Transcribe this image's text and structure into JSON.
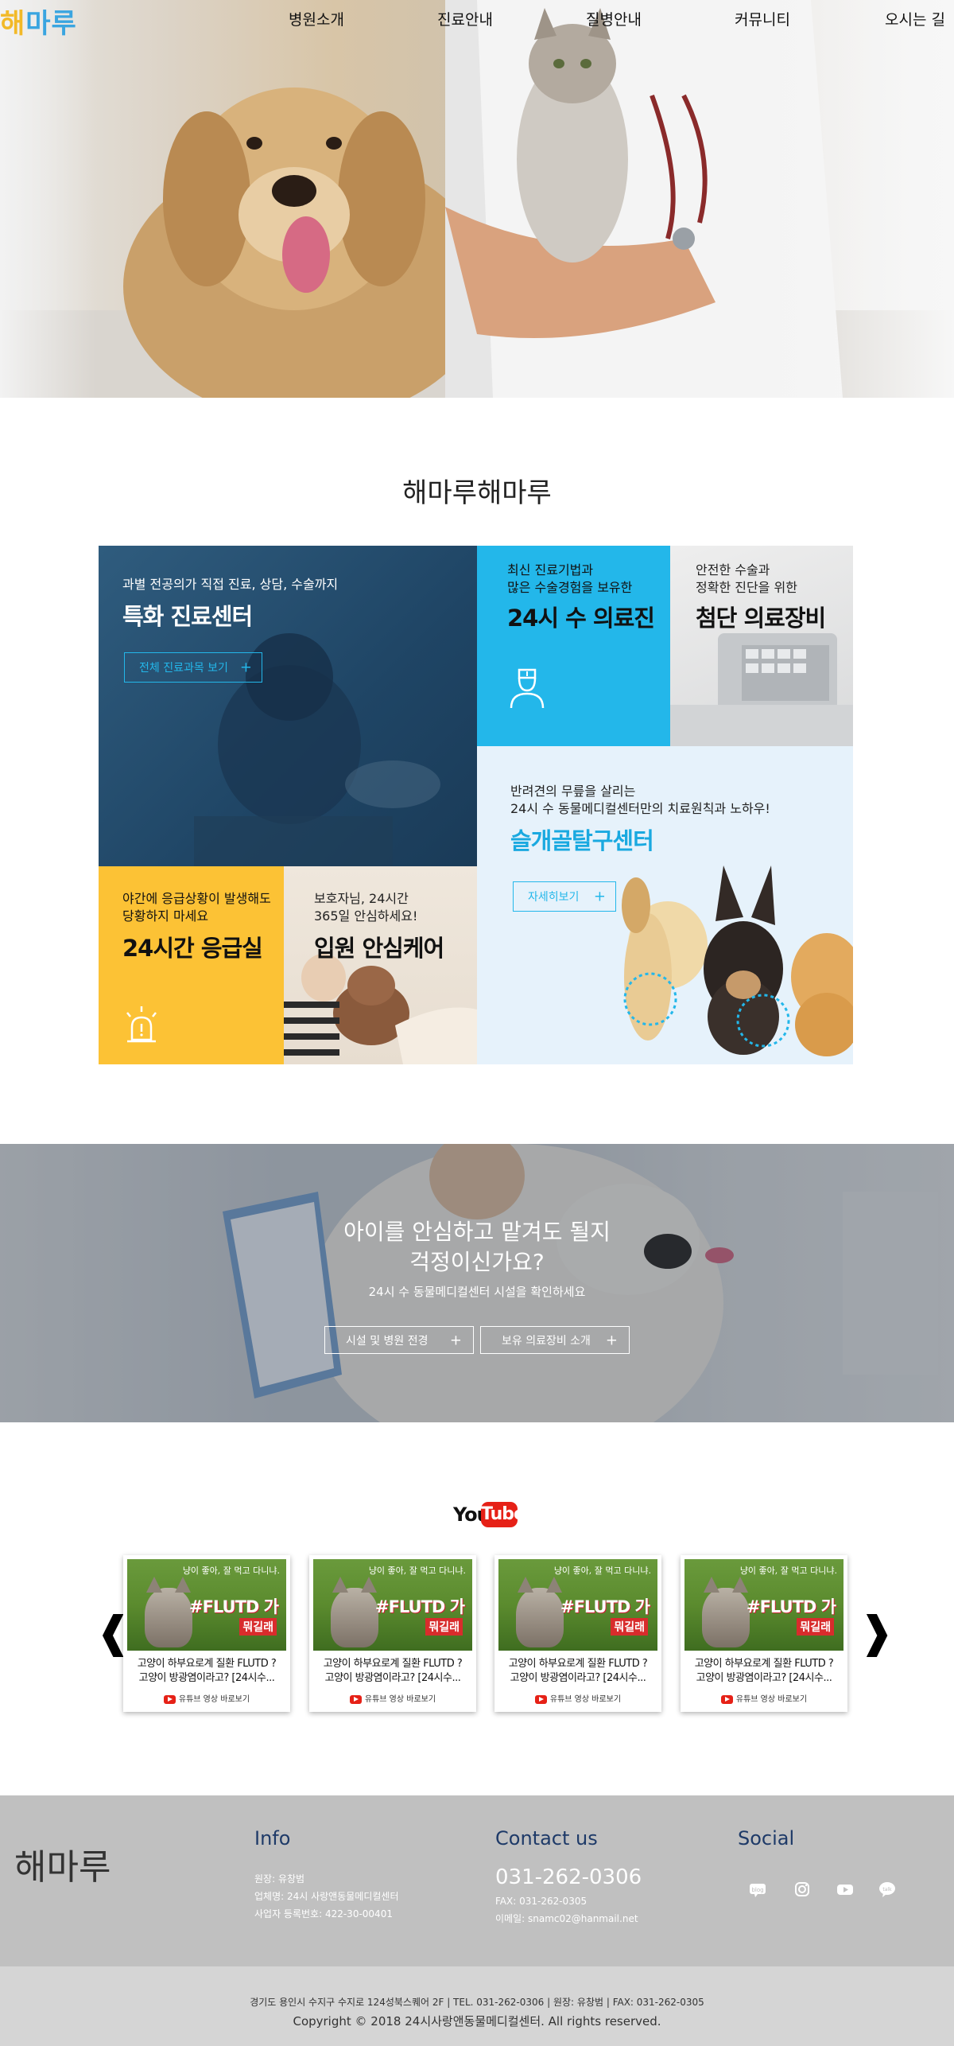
{
  "header": {
    "logo_part1": "해",
    "logo_part2": "마루",
    "nav": [
      "병원소개",
      "진료안내",
      "질병안내",
      "커뮤니티",
      "오시는 길"
    ]
  },
  "section_title": "해마루해마루",
  "tiles": {
    "special": {
      "sub": "과별 전공의가 직접 진료, 상담, 수술까지",
      "title": "특화 진료센터",
      "button": "전체 진료과목 보기"
    },
    "h24": {
      "sub1": "최신 진료기법과",
      "sub2": "많은 수술경험을 보유한",
      "title": "24시 수 의료진"
    },
    "equip": {
      "sub1": "안전한 수술과",
      "sub2": "정확한 진단을 위한",
      "title": "첨단 의료장비"
    },
    "knee": {
      "sub1": "반려견의 무릎을 살리는",
      "sub2": "24시 수 동물메디컬센터만의 치료원칙과 노하우!",
      "title": "슬개골탈구센터",
      "button": "자세히보기"
    },
    "emergency": {
      "sub1": "야간에 응급상황이 발생해도",
      "sub2": "당황하지 마세요",
      "title": "24시간 응급실"
    },
    "inpatient": {
      "sub1": "보호자님, 24시간",
      "sub2": "365일 안심하세요!",
      "title": "입원 안심케어"
    }
  },
  "banner": {
    "title1": "아이를 안심하고 맡겨도 될지",
    "title2": "걱정이신가요?",
    "sub": "24시 수 동물메디컬센터 시설을 확인하세요",
    "btn1": "시설 및 병원 전경",
    "btn2": "보유 의료장비 소개"
  },
  "youtube": {
    "logo_you": "You",
    "logo_tube": "Tube",
    "prev": "❰",
    "next": "❱",
    "cards": [
      {
        "line1": "고양이 하부요로계 질환 FLUTD ?",
        "line2": "고양이 방광염이라고? [24시수...",
        "link": "유튜브 영상 바로보기"
      },
      {
        "line1": "고양이 하부요로계 질환 FLUTD ?",
        "line2": "고양이 방광염이라고? [24시수...",
        "link": "유튜브 영상 바로보기"
      },
      {
        "line1": "고양이 하부요로계 질환 FLUTD ?",
        "line2": "고양이 방광염이라고? [24시수...",
        "link": "유튜브 영상 바로보기"
      },
      {
        "line1": "고양이 하부요로계 질환 FLUTD ?",
        "line2": "고양이 방광염이라고? [24시수...",
        "link": "유튜브 영상 바로보기"
      }
    ],
    "thumb": {
      "hand": "냥이 좋아, 잘 먹고 다니냐.",
      "big1": "#FLUTD 가",
      "big2": "뭐길래"
    }
  },
  "footer": {
    "logo": "해마루",
    "info_h": "Info",
    "info_lines": [
      "원장: 유창범",
      "업체명: 24시 사랑앤동물메디컬센터",
      "사업자 등록번호: 422-30-00401"
    ],
    "contact_h": "Contact us",
    "phone": "031-262-0306",
    "contact_lines": [
      "FAX: 031-262-0305",
      "이메일: snamc02@hanmail.net"
    ],
    "social_h": "Social",
    "social_icons": [
      "blog-icon",
      "instagram-icon",
      "youtube-icon",
      "talk-icon"
    ],
    "address": "경기도 용인시 수지구 수지로 124성북스퀘어 2F | TEL. 031-262-0306 | 원장: 유창범 | FAX: 031-262-0305",
    "copyright": "Copyright © 2018 24시사랑앤동물메디컬센터. All rights reserved."
  }
}
